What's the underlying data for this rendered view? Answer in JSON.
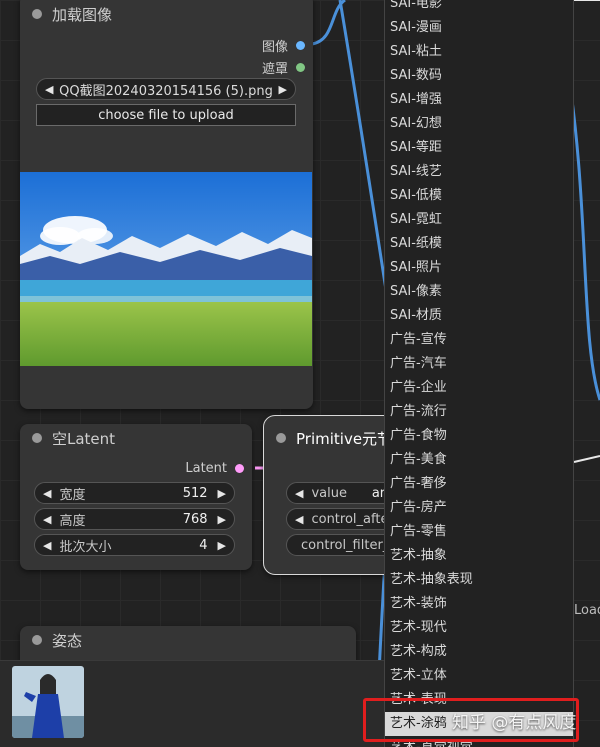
{
  "load_image_node": {
    "title": "加载图像",
    "outputs": {
      "image": "图像",
      "mask": "遮罩"
    },
    "file_selector": {
      "value": "QQ截图20240320154156 (5).png"
    },
    "upload_button": "choose file to upload"
  },
  "empty_latent_node": {
    "title": "空Latent",
    "output": "Latent",
    "widgets": [
      {
        "label": "宽度",
        "value": "512"
      },
      {
        "label": "高度",
        "value": "768"
      },
      {
        "label": "批次大小",
        "value": "4"
      }
    ]
  },
  "primitive_node": {
    "title": "Primitive元节",
    "widgets": [
      {
        "label": "value",
        "value": "arts"
      },
      {
        "label": "control_after_",
        "value": ""
      },
      {
        "label": "control_filter_l",
        "value": ""
      }
    ]
  },
  "style_node": {
    "title": "姿态"
  },
  "right_partial_label": "Load",
  "dropdown_menu": {
    "items": [
      "SAI-电影",
      "SAI-漫画",
      "SAI-粘土",
      "SAI-数码",
      "SAI-增强",
      "SAI-幻想",
      "SAI-等距",
      "SAI-线艺",
      "SAI-低模",
      "SAI-霓虹",
      "SAI-纸模",
      "SAI-照片",
      "SAI-像素",
      "SAI-材质",
      "广告-宣传",
      "广告-汽车",
      "广告-企业",
      "广告-流行",
      "广告-食物",
      "广告-美食",
      "广告-奢侈",
      "广告-房产",
      "广告-零售",
      "艺术-抽象",
      "艺术-抽象表现",
      "艺术-装饰",
      "艺术-现代",
      "艺术-构成",
      "艺术-立体",
      "艺术-表现",
      "艺术-涂鸦",
      "艺术-直觉视觉"
    ],
    "highlighted_index": 30
  },
  "watermark": "知乎 @有点风度",
  "colors": {
    "image_slot": "#6ab7ff",
    "mask_slot": "#81c784",
    "latent_slot": "#ff9cf9",
    "link_blue": "#4a90d9",
    "highlight_red": "#e01e1e"
  }
}
